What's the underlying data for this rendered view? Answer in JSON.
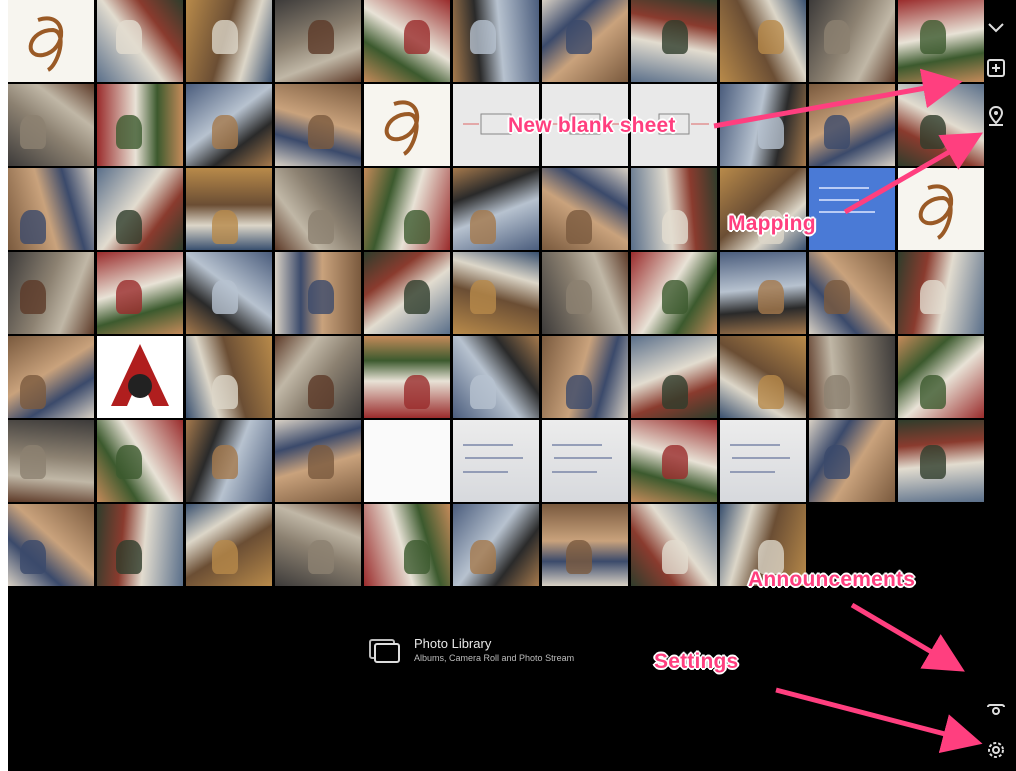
{
  "photo_library": {
    "title": "Photo Library",
    "subtitle": "Albums, Camera Roll and Photo Stream"
  },
  "toolbar": {
    "collapse_icon": "chevron-down-icon",
    "new_sheet_icon": "new-blank-sheet-icon",
    "mapping_icon": "map-pin-icon",
    "announcements_icon": "announcements-icon",
    "settings_icon": "gear-icon"
  },
  "annotations": {
    "new_blank_sheet": "New blank sheet",
    "mapping": "Mapping",
    "announcements": "Announcements",
    "settings": "Settings",
    "color": "#ff3f7f"
  },
  "thumbnails": {
    "rows": [
      [
        "drawing",
        "photo",
        "photo",
        "photo",
        "photo",
        "photo",
        "photo",
        "photo",
        "photo",
        "photo",
        "photo"
      ],
      [
        "photo",
        "photo",
        "photo",
        "photo",
        "drawing",
        "sheet",
        "sheet",
        "sheet",
        "photo",
        "photo",
        "photo"
      ],
      [
        "photo",
        "photo",
        "photo",
        "photo",
        "photo",
        "photo",
        "photo",
        "photo",
        "photo",
        "map",
        "drawing"
      ],
      [
        "photo",
        "photo",
        "photo",
        "photo",
        "photo",
        "photo",
        "photo",
        "photo",
        "photo",
        "photo",
        "photo"
      ],
      [
        "photo",
        "logo",
        "photo",
        "photo",
        "photo",
        "photo",
        "photo",
        "photo",
        "photo",
        "photo",
        "photo"
      ],
      [
        "photo",
        "photo",
        "photo",
        "photo",
        "blank",
        "whiteboard",
        "whiteboard",
        "photo",
        "whiteboard",
        "photo",
        "photo"
      ],
      [
        "photo",
        "photo",
        "photo",
        "photo",
        "photo",
        "photo",
        "photo",
        "photo",
        "photo"
      ]
    ]
  }
}
